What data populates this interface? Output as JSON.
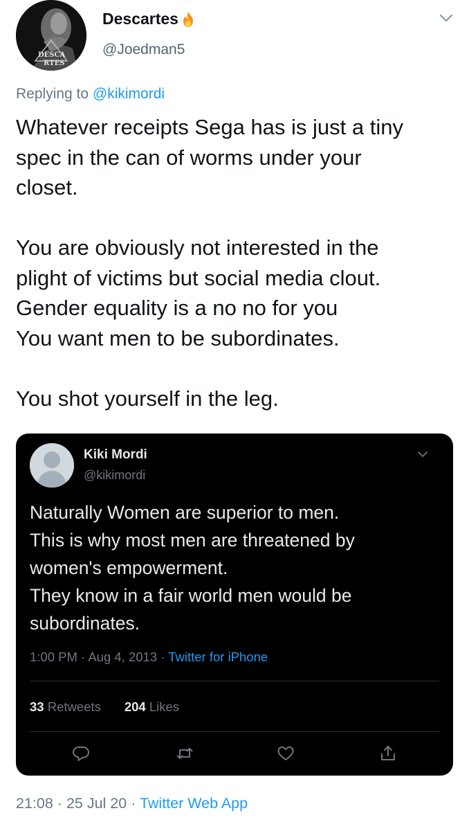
{
  "author": {
    "display_name": "Descartes",
    "handle": "@Joedman5",
    "avatar_text_top": "DESCA",
    "avatar_text_bottom": "RTES",
    "badge_icon": "fire-icon"
  },
  "reply": {
    "prefix": "Replying to ",
    "to": "@kikimordi"
  },
  "tweet": {
    "text": "Whatever receipts Sega has is just a tiny\nspec in the can of worms under your\ncloset.\n\nYou are obviously not interested in the\nplight of victims  but social media clout.\nGender equality is a no no for you\nYou want men to be subordinates.\n\nYou shot yourself in the leg."
  },
  "quoted": {
    "display_name": "Kiki Mordi",
    "handle": "@kikimordi",
    "text": "Naturally Women are superior to men.\nThis is why most men are threatened by\nwomen's empowerment.\nThey know in a fair world men would be\nsubordinates.",
    "time": "1:00 PM",
    "date": "Aug 4, 2013",
    "source": "Twitter for iPhone",
    "retweets_count": "33",
    "retweets_label": "Retweets",
    "likes_count": "204",
    "likes_label": "Likes"
  },
  "footer": {
    "time": "21:08",
    "date": "25 Jul 20",
    "app": "Twitter Web App"
  },
  "colors": {
    "link": "#1d9bf0",
    "secondary_text": "#657786",
    "card_bg": "#000000"
  }
}
